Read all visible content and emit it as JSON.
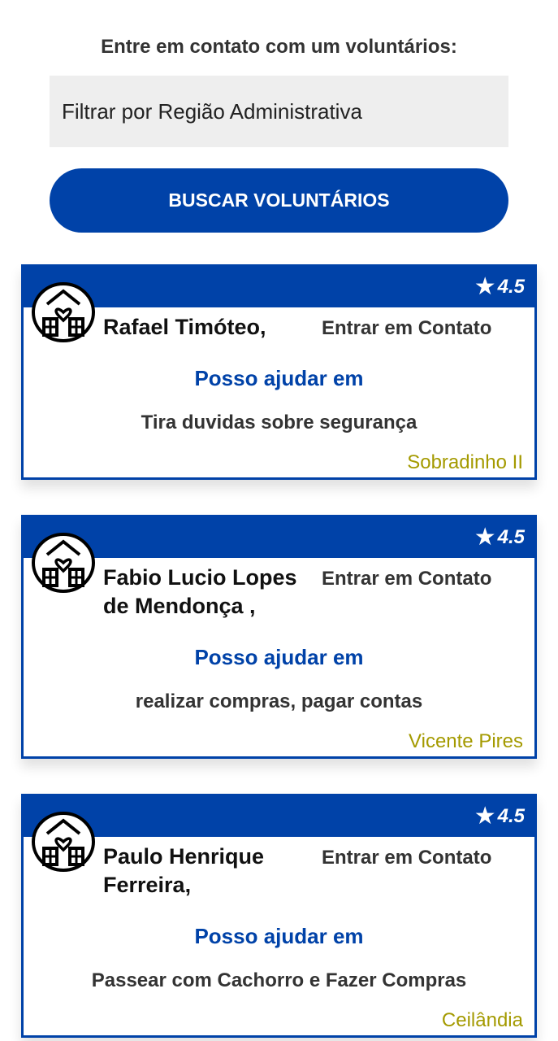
{
  "header": {
    "title": "Entre em contato com um voluntários:"
  },
  "filter": {
    "label": "Filtrar por Região Administrativa"
  },
  "search": {
    "button_label": "BUSCAR VOLUNTÁRIOS"
  },
  "colors": {
    "primary": "#0042a8",
    "region": "#a49a00"
  },
  "volunteers": [
    {
      "rating": "4.5",
      "name": "Rafael Timóteo,",
      "contact_label": "Entrar em Contato",
      "help_title": "Posso ajudar em",
      "help_text": "Tira duvidas sobre segurança",
      "region": "Sobradinho II",
      "avatar_icon": "volunteer-house-heart-icon"
    },
    {
      "rating": "4.5",
      "name": "Fabio Lucio Lopes de Mendonça ,",
      "contact_label": "Entrar em Contato",
      "help_title": "Posso ajudar em",
      "help_text": "realizar compras, pagar contas",
      "region": "Vicente Pires",
      "avatar_icon": "volunteer-house-heart-icon"
    },
    {
      "rating": "4.5",
      "name": "Paulo Henrique Ferreira,",
      "contact_label": "Entrar em Contato",
      "help_title": "Posso ajudar em",
      "help_text": "Passear com Cachorro e Fazer Compras",
      "region": "Ceilândia",
      "avatar_icon": "volunteer-house-heart-icon"
    }
  ]
}
